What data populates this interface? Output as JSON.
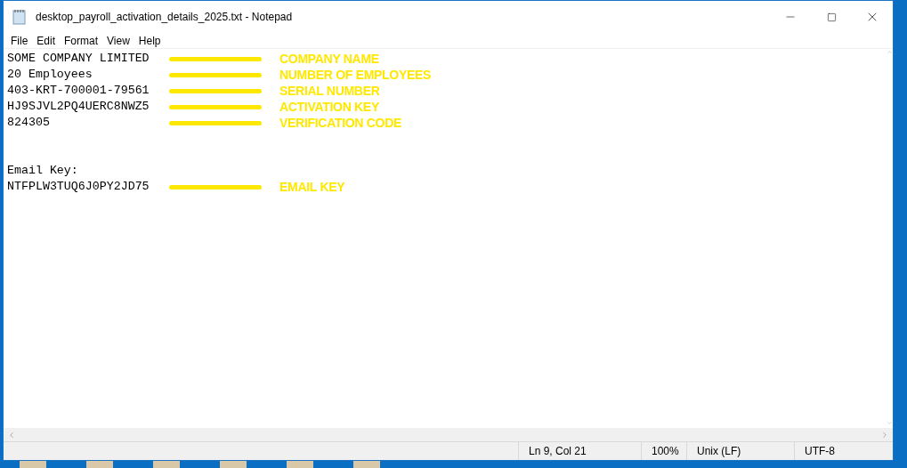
{
  "window": {
    "title": "desktop_payroll_activation_details_2025.txt - Notepad"
  },
  "menu": [
    "File",
    "Edit",
    "Format",
    "View",
    "Help"
  ],
  "lines": [
    {
      "kind": "text",
      "text": "SOME COMPANY LIMITED",
      "annotation": "COMPANY NAME"
    },
    {
      "kind": "text",
      "text": "20 Employees",
      "annotation": "NUMBER OF EMPLOYEES"
    },
    {
      "kind": "text",
      "text": "403-KRT-700001-79561",
      "annotation": "SERIAL NUMBER"
    },
    {
      "kind": "text",
      "text": "HJ9SJVL2PQ4UERC8NWZ5",
      "annotation": "ACTIVATION KEY"
    },
    {
      "kind": "text",
      "text": "824305",
      "annotation": "VERIFICATION CODE"
    },
    {
      "kind": "blank"
    },
    {
      "kind": "blank"
    },
    {
      "kind": "text",
      "text": "Email Key:"
    },
    {
      "kind": "text",
      "text": "NTFPLW3TUQ6J0PY2JD75",
      "annotation": "EMAIL KEY"
    }
  ],
  "status_bar": [
    "Ln 9, Col 21",
    "100%",
    "Unix (LF)",
    "UTF-8"
  ]
}
